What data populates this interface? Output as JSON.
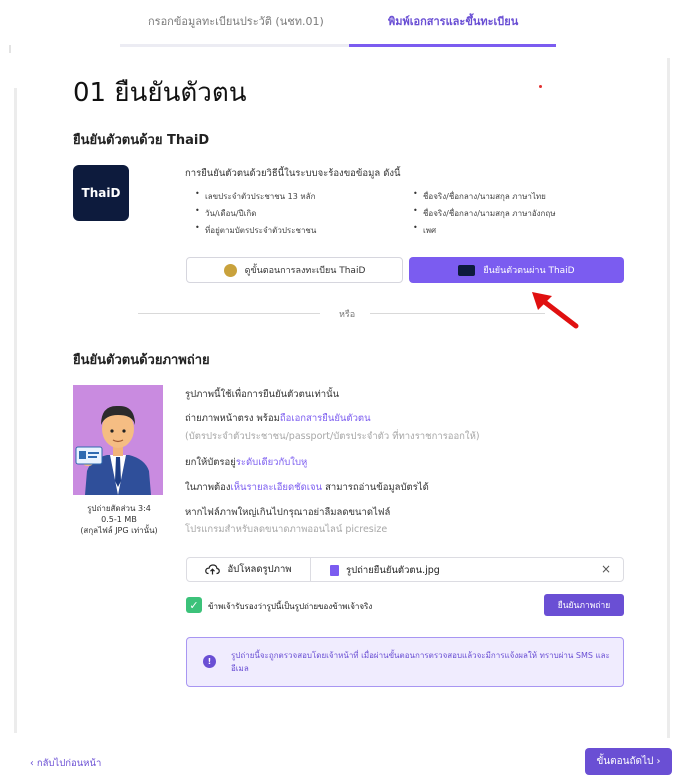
{
  "tabs": {
    "tab1": "กรอกข้อมูลทะเบียนประวัติ (นชท.01)",
    "tab2": "พิมพ์เอกสารและขึ้นทะเบียน"
  },
  "page_title": "01 ยืนยันตัวตน",
  "thaid_section": {
    "title": "ยืนยันตัวตนด้วย ThaiD",
    "logo_text": "ThaiD",
    "intro": "การยืนยันตัวตนด้วยวิธีนี้ในระบบจะร้องขอข้อมูล ดังนี้",
    "items_left": [
      "เลขประจำตัวประชาชน 13 หลัก",
      "วัน/เดือน/ปีเกิด",
      "ที่อยู่ตามบัตรประจำตัวประชาชน"
    ],
    "items_right": [
      "ชื่อจริง/ชื่อกลาง/นามสกุล ภาษาไทย",
      "ชื่อจริง/ชื่อกลาง/นามสกุล ภาษาอังกฤษ",
      "เพศ"
    ],
    "guide_button": "ดูขั้นตอนการลงทะเบียน ThaiD",
    "verify_button": "ยืนยันตัวตนผ่าน ThaiD"
  },
  "or_label": "หรือ",
  "photo_section": {
    "title": "ยืนยันตัวตนด้วยภาพถ่าย",
    "note": {
      "ratio": "รูปถ่ายสัดส่วน 3:4",
      "size": "0.5-1 MB",
      "format": "(สกุลไฟล์ JPG เท่านั้น)"
    },
    "line1": "รูปภาพนี้ใช้เพื่อการยืนยันตัวตนเท่านั้น",
    "line2_a": "ถ่ายภาพหน้าตรง พร้อม",
    "line2_link": "ถือเอกสารยืนยันตัวตน",
    "line3": "(บัตรประจำตัวประชาชน/passport/บัตรประจำตัว ที่ทางราชการออกให้)",
    "line4_a": "ยกให้บัตรอยู่",
    "line4_link": "ระดับเดียวกับใบหู",
    "line5_a": "ในภาพต้อง",
    "line5_link": "เห็นรายละเอียดชัดเจน",
    "line5_b": " สามารถอ่านข้อมูลบัตรได้",
    "line6": "หากไฟล์ภาพใหญ่เกินไปกรุณาอย่าลืมลดขนาดไฟล์",
    "line7": "โปรแกรมสำหรับลดขนาดภาพออนไลน์ picresize",
    "upload_button": "อัปโหลดรูปภาพ",
    "file_name": "รูปถ่ายยืนยันตัวตน.jpg",
    "clear": "×",
    "consent": "ข้าพเจ้ารับรองว่ารูปนี้เป็นรูปถ่ายของข้าพเจ้าจริง",
    "confirm_button": "ยืนยันภาพถ่าย",
    "notice_icon": "!",
    "notice": "รูปถ่ายนี้จะถูกตรวจสอบโดยเจ้าหน้าที่ เมื่อผ่านขั้นตอนการตรวจสอบแล้วจะมีการแจ้งผลให้ ทราบผ่าน SMS และอีเมล"
  },
  "footer": {
    "back": "‹  กลับไปก่อนหน้า",
    "next": "ขั้นตอนถัดไป  ›"
  },
  "colors": {
    "accent": "#7b5cf0",
    "accent_dark": "#6a4fd4",
    "success": "#3cc27a",
    "thaid_navy": "#0d1b3d",
    "annotation_red": "#e01010"
  },
  "icons": [
    "thaid-logo",
    "gold-seal-icon",
    "thaid-mini-icon",
    "red-arrow-icon",
    "cloud-upload-icon",
    "image-file-icon",
    "close-icon",
    "check-icon",
    "info-icon"
  ]
}
